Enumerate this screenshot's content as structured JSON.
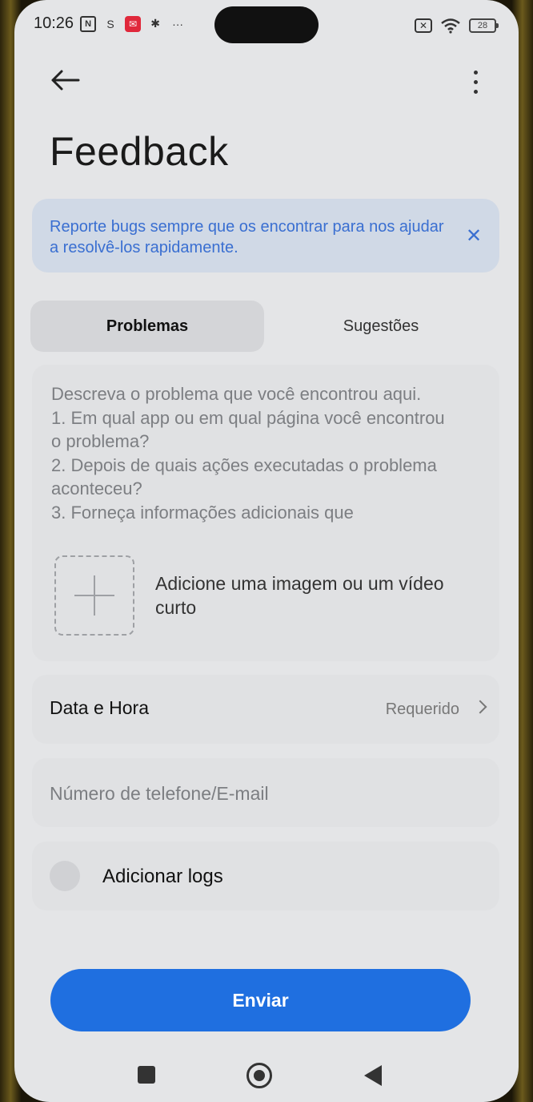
{
  "status_bar": {
    "time": "10:26",
    "battery": "28"
  },
  "header": {
    "title": "Feedback"
  },
  "banner": {
    "text": "Reporte bugs sempre que os encontrar para nos ajudar a resolvê-los rapidamente."
  },
  "tabs": [
    {
      "label": "Problemas",
      "active": true
    },
    {
      "label": "Sugestões",
      "active": false
    }
  ],
  "description": {
    "placeholder": "Descreva o problema que você encontrou aqui.\n1. Em qual app ou em qual página você encontrou o problema?\n2. Depois de quais ações executadas o problema aconteceu?\n3. Forneça informações adicionais que"
  },
  "media": {
    "label": "Adicione uma imagem ou um vídeo curto"
  },
  "date_time": {
    "label": "Data e Hora",
    "value": "Requerido"
  },
  "contact": {
    "placeholder": "Número de telefone/E-mail"
  },
  "logs": {
    "label": "Adicionar logs"
  },
  "submit": {
    "label": "Enviar"
  },
  "colors": {
    "accent": "#1f6fe0",
    "banner_bg": "#d0d9e6",
    "banner_text": "#3a6fd1",
    "background": "#e4e5e7"
  }
}
